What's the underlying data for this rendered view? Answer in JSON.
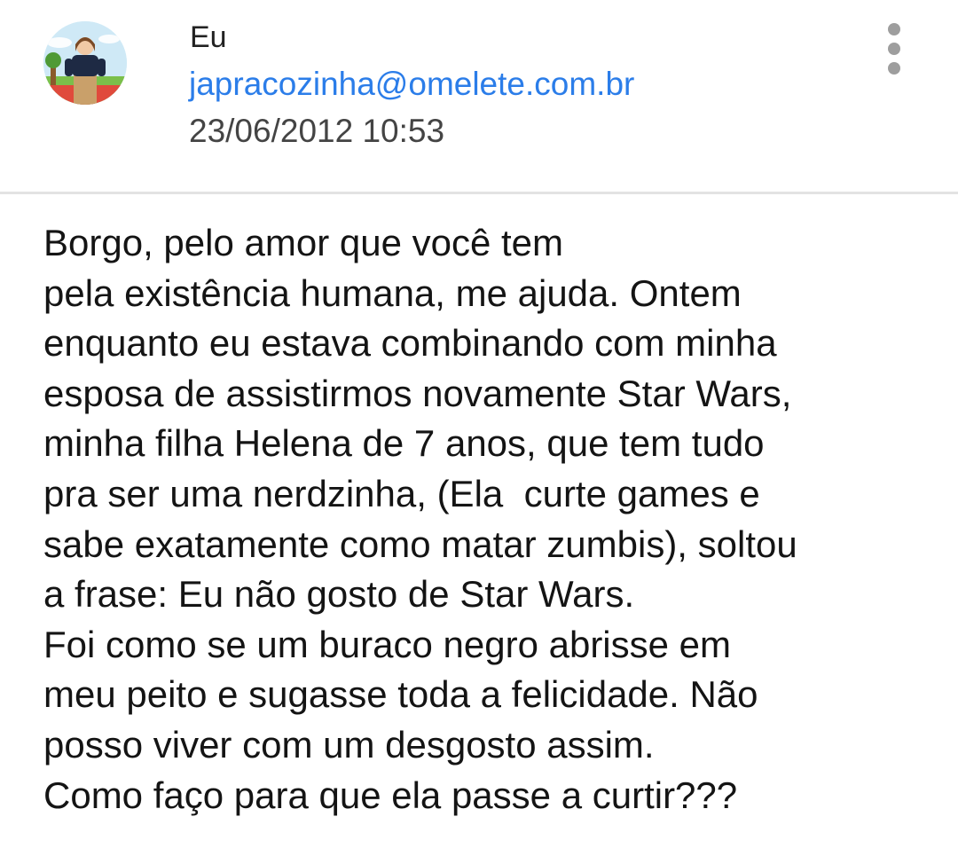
{
  "message": {
    "sender_name": "Eu",
    "sender_email": "japracozinha@omelete.com.br",
    "date": "23/06/2012 10:53",
    "more_icon": "more-vertical-icon",
    "body_lines": [
      "Borgo, pelo amor que você tem",
      "pela existência humana, me ajuda. Ontem",
      "enquanto eu estava combinando com minha",
      "esposa de assistirmos novamente Star Wars,",
      "minha filha Helena de 7 anos, que tem tudo",
      "pra ser uma nerdzinha, (Ela  curte games e",
      "sabe exatamente como matar zumbis), soltou",
      "a frase: Eu não gosto de Star Wars.",
      "Foi como se um buraco negro abrisse em",
      "meu peito e sugasse toda a felicidade. Não",
      "posso viver com um desgosto assim.",
      "Como faço para que ela passe a curtir???"
    ]
  },
  "colors": {
    "email_link": "#2b7de9",
    "icon_gray": "#9e9e9e",
    "divider": "#e3e3e3"
  }
}
